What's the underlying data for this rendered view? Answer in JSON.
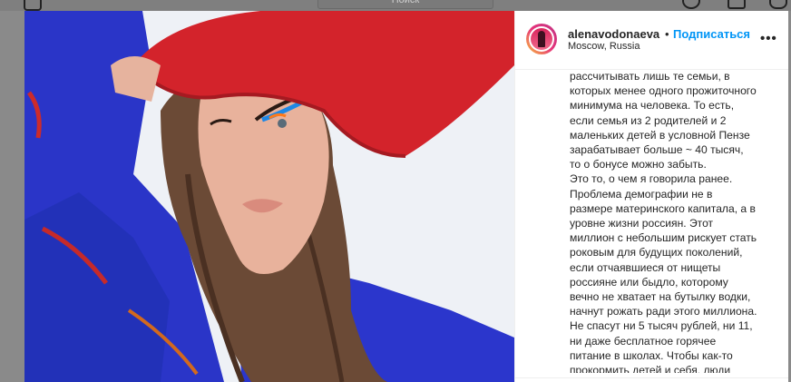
{
  "topbar": {
    "search_placeholder": "Поиск"
  },
  "post": {
    "username": "alenavodonaeva",
    "separator": "•",
    "follow_label": "Подписаться",
    "location": "Moscow, Russia",
    "more_label": "•••",
    "caption_lines": [
      "рассчитывать лишь те семьи, в",
      "которых менее одного прожиточного",
      "минимума на человека. То есть,",
      "если семья из 2 родителей и 2",
      "маленьких детей в условной Пензе",
      "зарабатывает больше ~ 40 тысяч,",
      "то о бонусе можно забыть.",
      "Это то, о чем я говорила ранее.",
      "Проблема демографии не в",
      "размере материнского капитала, а в",
      "уровне жизни россиян. Этот",
      "миллион с небольшим рискует стать",
      "роковым для будущих поколений,",
      "если отчаявшиеся от нищеты",
      "россияне или быдло, которому",
      "вечно не хватает на бутылку водки,",
      "начнут рожать ради этого миллиона.",
      "Не спасут ни 5 тысяч рублей, ни 11,",
      "ни даже бесплатное горячее",
      "питание в школах. Чтобы как-то",
      "прокормить детей и себя, люди"
    ]
  },
  "colors": {
    "accent": "#0095f6",
    "text": "#262626",
    "backdrop": "#8a8a8a"
  }
}
